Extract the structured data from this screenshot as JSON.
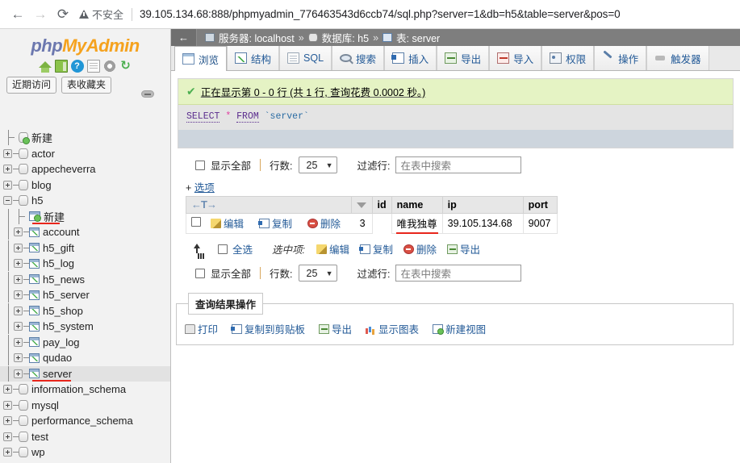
{
  "browser": {
    "back_icon": "←",
    "forward_icon": "→",
    "reload_icon": "⟳",
    "security_label": "不安全",
    "url": "39.105.134.68:888/phpmyadmin_776463543d6ccb74/sql.php?server=1&db=h5&table=server&pos=0"
  },
  "sidebar": {
    "logo": {
      "php": "php",
      "my": "My",
      "admin": "Admin"
    },
    "logo_icons": [
      {
        "name": "home-icon",
        "glyph": ""
      },
      {
        "name": "logout-icon",
        "glyph": ""
      },
      {
        "name": "help-icon",
        "glyph": "?"
      },
      {
        "name": "documentation-icon",
        "glyph": ""
      },
      {
        "name": "settings-gear-icon",
        "glyph": ""
      },
      {
        "name": "reload-icon",
        "glyph": "↻"
      }
    ],
    "quick_tabs": [
      {
        "label": "近期访问"
      },
      {
        "label": "表收藏夹"
      }
    ],
    "tree": [
      {
        "label": "新建",
        "type": "new-db",
        "depth": 0,
        "expander": "none",
        "selected": false,
        "underline": false
      },
      {
        "label": "actor",
        "type": "db",
        "depth": 0,
        "expander": "plus",
        "selected": false,
        "underline": false
      },
      {
        "label": "appecheverra",
        "type": "db",
        "depth": 0,
        "expander": "plus",
        "selected": false,
        "underline": false
      },
      {
        "label": "blog",
        "type": "db",
        "depth": 0,
        "expander": "plus",
        "selected": false,
        "underline": false
      },
      {
        "label": "h5",
        "type": "db",
        "depth": 0,
        "expander": "minus",
        "selected": false,
        "underline": false
      },
      {
        "label": "新建",
        "type": "new-table",
        "depth": 1,
        "expander": "none",
        "selected": false,
        "underline": true
      },
      {
        "label": "account",
        "type": "table",
        "depth": 1,
        "expander": "plus",
        "selected": false,
        "underline": false
      },
      {
        "label": "h5_gift",
        "type": "table",
        "depth": 1,
        "expander": "plus",
        "selected": false,
        "underline": false
      },
      {
        "label": "h5_log",
        "type": "table",
        "depth": 1,
        "expander": "plus",
        "selected": false,
        "underline": false
      },
      {
        "label": "h5_news",
        "type": "table",
        "depth": 1,
        "expander": "plus",
        "selected": false,
        "underline": false
      },
      {
        "label": "h5_server",
        "type": "table",
        "depth": 1,
        "expander": "plus",
        "selected": false,
        "underline": false
      },
      {
        "label": "h5_shop",
        "type": "table",
        "depth": 1,
        "expander": "plus",
        "selected": false,
        "underline": false
      },
      {
        "label": "h5_system",
        "type": "table",
        "depth": 1,
        "expander": "plus",
        "selected": false,
        "underline": false
      },
      {
        "label": "pay_log",
        "type": "table",
        "depth": 1,
        "expander": "plus",
        "selected": false,
        "underline": false
      },
      {
        "label": "qudao",
        "type": "table",
        "depth": 1,
        "expander": "plus",
        "selected": false,
        "underline": false
      },
      {
        "label": "server",
        "type": "table",
        "depth": 1,
        "expander": "plus",
        "selected": true,
        "underline": true
      },
      {
        "label": "information_schema",
        "type": "db",
        "depth": 0,
        "expander": "plus",
        "selected": false,
        "underline": false
      },
      {
        "label": "mysql",
        "type": "db",
        "depth": 0,
        "expander": "plus",
        "selected": false,
        "underline": false
      },
      {
        "label": "performance_schema",
        "type": "db",
        "depth": 0,
        "expander": "plus",
        "selected": false,
        "underline": false
      },
      {
        "label": "test",
        "type": "db",
        "depth": 0,
        "expander": "plus",
        "selected": false,
        "underline": false
      },
      {
        "label": "wp",
        "type": "db",
        "depth": 0,
        "expander": "plus",
        "selected": false,
        "underline": false
      }
    ]
  },
  "breadcrumb": {
    "back_icon": "←",
    "server_label": "服务器: localhost",
    "sep": "»",
    "db_label": "数据库: h5",
    "table_label": "表: server"
  },
  "tabs": [
    {
      "label": "浏览",
      "icon": "browse-icon",
      "active": true
    },
    {
      "label": "结构",
      "icon": "structure-icon",
      "active": false
    },
    {
      "label": "SQL",
      "icon": "sql-icon",
      "active": false
    },
    {
      "label": "搜索",
      "icon": "search-icon",
      "active": false
    },
    {
      "label": "插入",
      "icon": "insert-icon",
      "active": false
    },
    {
      "label": "导出",
      "icon": "export-icon",
      "active": false
    },
    {
      "label": "导入",
      "icon": "import-icon",
      "active": false
    },
    {
      "label": "权限",
      "icon": "privileges-icon",
      "active": false
    },
    {
      "label": "操作",
      "icon": "operations-wrench-icon",
      "active": false
    },
    {
      "label": "触发器",
      "icon": "triggers-icon",
      "active": false
    }
  ],
  "result": {
    "message": "正在显示第 0 - 0 行 (共 1 行, 查询花费 0.0002 秒。)",
    "sql_keyword_select": "SELECT",
    "sql_star": "*",
    "sql_keyword_from": "FROM",
    "sql_table": "`server`"
  },
  "options_bar": {
    "show_all_label": "显示全部",
    "rows_label": "行数:",
    "rows_value": "25",
    "filter_label": "过滤行:",
    "filter_placeholder": "在表中搜索",
    "options_plus": "+",
    "options_label": "选项"
  },
  "table": {
    "nav_arrows": "←T→",
    "columns": [
      "id",
      "name",
      "ip",
      "port"
    ],
    "row_actions": [
      {
        "label": "编辑",
        "icon": "edit-pencil-icon"
      },
      {
        "label": "复制",
        "icon": "copy-icon"
      },
      {
        "label": "删除",
        "icon": "delete-icon"
      }
    ],
    "rows": [
      {
        "id": "3",
        "name": "唯我独尊",
        "ip": "39.105.134.68",
        "port": "9007"
      }
    ]
  },
  "selection_actions": {
    "check_all_label": "全选",
    "with_selected_label": "选中项:",
    "actions": [
      {
        "label": "编辑",
        "icon": "edit-pencil-icon"
      },
      {
        "label": "复制",
        "icon": "copy-icon"
      },
      {
        "label": "删除",
        "icon": "delete-icon"
      },
      {
        "label": "导出",
        "icon": "export-icon"
      }
    ]
  },
  "query_results_ops": {
    "legend": "查询结果操作",
    "links": [
      {
        "label": "打印",
        "icon": "print-icon"
      },
      {
        "label": "复制到剪贴板",
        "icon": "clipboard-icon"
      },
      {
        "label": "导出",
        "icon": "export-icon"
      },
      {
        "label": "显示图表",
        "icon": "chart-icon"
      },
      {
        "label": "新建视图",
        "icon": "new-view-icon"
      }
    ]
  },
  "colors": {
    "accent_link": "#235a97",
    "success_bg": "#e5f3c4",
    "highlight_red": "#e8261c",
    "logo_orange": "#f5a21e",
    "logo_blue": "#6c78af"
  }
}
